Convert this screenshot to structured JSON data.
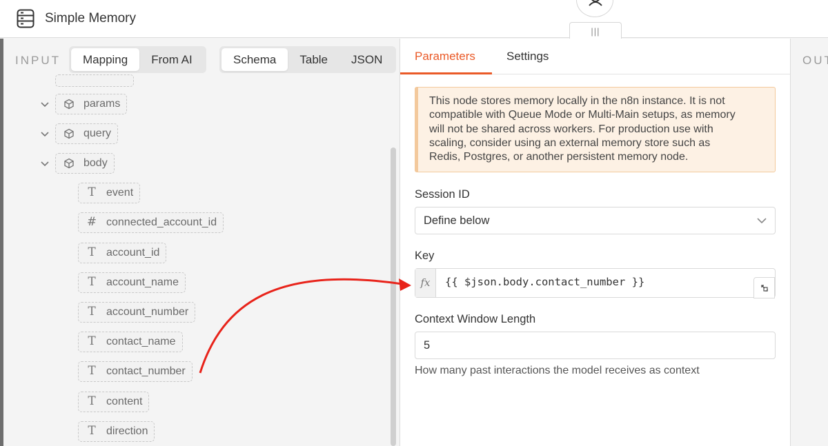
{
  "header": {
    "title": "Simple Memory",
    "node_icon": "server-icon"
  },
  "input_panel": {
    "label": "INPUT",
    "mode_options": [
      "Mapping",
      "From AI"
    ],
    "active_mode": "Mapping",
    "view_options": [
      "Schema",
      "Table",
      "JSON"
    ],
    "active_view": "Schema",
    "tree": [
      {
        "label": "params",
        "type": "object",
        "expanded": true
      },
      {
        "label": "query",
        "type": "object",
        "expanded": true
      },
      {
        "label": "body",
        "type": "object",
        "expanded": true
      },
      {
        "label": "event",
        "type": "string"
      },
      {
        "label": "connected_account_id",
        "type": "number"
      },
      {
        "label": "account_id",
        "type": "string"
      },
      {
        "label": "account_name",
        "type": "string"
      },
      {
        "label": "account_number",
        "type": "string"
      },
      {
        "label": "contact_name",
        "type": "string"
      },
      {
        "label": "contact_number",
        "type": "string"
      },
      {
        "label": "content",
        "type": "string"
      },
      {
        "label": "direction",
        "type": "string"
      }
    ],
    "type_glyphs": {
      "string": "T",
      "number": "#"
    }
  },
  "drag_handle": {
    "glyph": "|||"
  },
  "parameters_panel": {
    "tabs": [
      "Parameters",
      "Settings"
    ],
    "active_tab": "Parameters",
    "notice_lines": [
      "This node stores memory locally in the n8n instance. It is not",
      "compatible with Queue Mode or Multi-Main setups, as memory",
      "will not be shared across workers. For production use with",
      "scaling, consider using an external memory store such as",
      "Redis, Postgres, or another persistent memory node."
    ],
    "session_id": {
      "label": "Session ID",
      "value": "Define below"
    },
    "key": {
      "label": "Key",
      "fx": "fx",
      "expression": "{{ $json.body.contact_number }}"
    },
    "context_window": {
      "label": "Context Window Length",
      "value": "5",
      "hint": "How many past interactions the model receives as context"
    }
  },
  "output_panel": {
    "label": "OUTPUT"
  },
  "colors": {
    "accent": "#ea5a28",
    "notice_bg": "#fdf1e4",
    "notice_border": "#f3c99c",
    "arrow": "#e8231a"
  }
}
